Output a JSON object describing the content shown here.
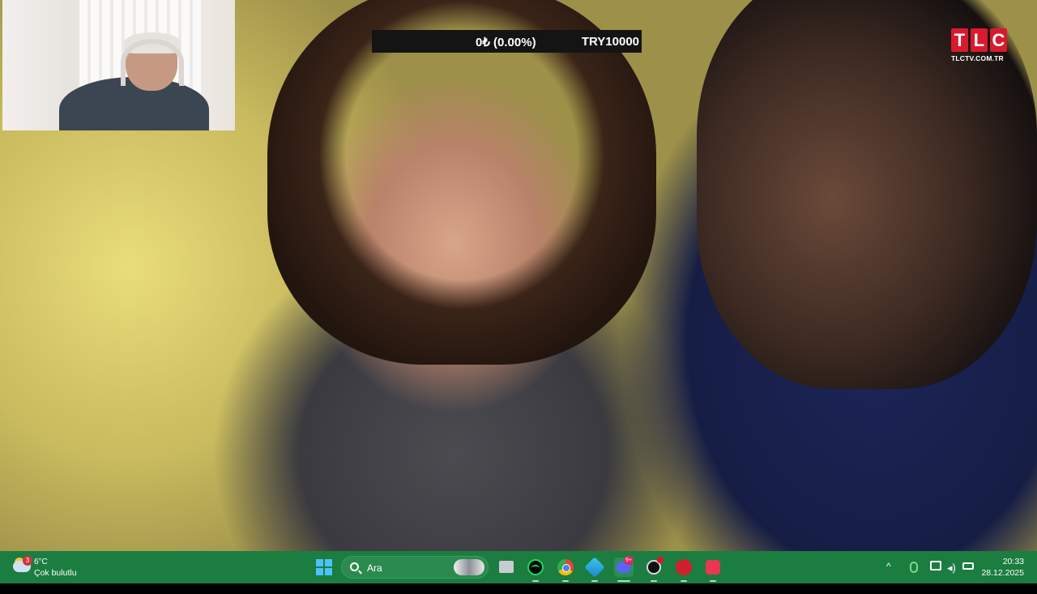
{
  "overlay": {
    "ticker": {
      "change": "0₺ (0.00%)",
      "price": "TRY10000"
    },
    "channel_logo": {
      "letters": [
        "T",
        "L",
        "C"
      ],
      "domain": "TLCTV.COM.TR",
      "color": "#d81b2c"
    }
  },
  "taskbar": {
    "background": "#1c7d40",
    "weather": {
      "badge": "3",
      "temperature": "6°C",
      "condition": "Çok bulutlu",
      "icon": "partly-cloudy-icon"
    },
    "start": {
      "icon": "windows-start-icon"
    },
    "search": {
      "placeholder": "Ara",
      "icon": "search-icon"
    },
    "apps": [
      {
        "name": "files-app",
        "icon": "folder-icon"
      },
      {
        "name": "spotify-app",
        "icon": "spotify-icon"
      },
      {
        "name": "chrome-app",
        "icon": "chrome-icon"
      },
      {
        "name": "vpn-app",
        "icon": "diamond-icon"
      },
      {
        "name": "discord-app",
        "icon": "discord-icon",
        "badge": "9+",
        "active": true
      },
      {
        "name": "steam-app",
        "icon": "steam-icon"
      },
      {
        "name": "game-app",
        "icon": "red-app-icon"
      },
      {
        "name": "pocket-app",
        "icon": "pocket-icon"
      }
    ],
    "tray": {
      "icons": [
        "chevron-up-icon",
        "microphone-icon",
        "network-icon",
        "volume-icon",
        "battery-icon"
      ],
      "time": "20:33",
      "date": "28.12.2025"
    }
  }
}
